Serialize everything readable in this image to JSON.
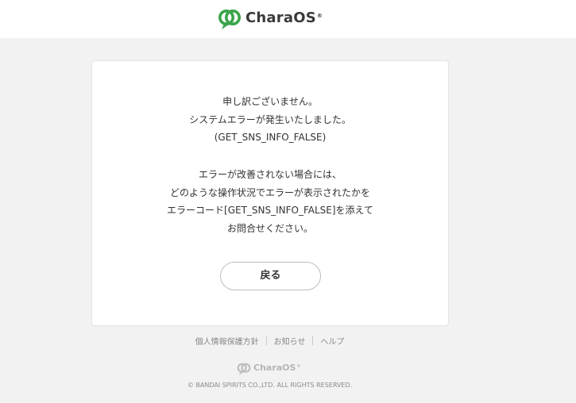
{
  "header": {
    "logo_text": "CharaOS",
    "logo_reg": "®"
  },
  "colors": {
    "brand_green": "#3aa54b",
    "background": "#f2f2f2",
    "card": "#ffffff"
  },
  "error": {
    "lines_top": [
      "申し訳ございません。",
      "システムエラーが発生いたしました。",
      "(GET_SNS_INFO_FALSE)"
    ],
    "lines_bottom": [
      "エラーが改善されない場合には、",
      "どのような操作状況でエラーが表示されたかを",
      "エラーコード[GET_SNS_INFO_FALSE]を添えて",
      "お問合せください。"
    ],
    "back_button_label": "戻る"
  },
  "footer": {
    "links": [
      "個人情報保護方針",
      "お知らせ",
      "ヘルプ"
    ],
    "logo_text": "CharaOS",
    "logo_reg": "®",
    "copyright": "© BANDAI SPIRITS CO.,LTD. ALL RIGHTS RESERVED."
  },
  "icons": {
    "logo": "charaos-logo-icon",
    "footer_logo": "charaos-logo-icon"
  }
}
